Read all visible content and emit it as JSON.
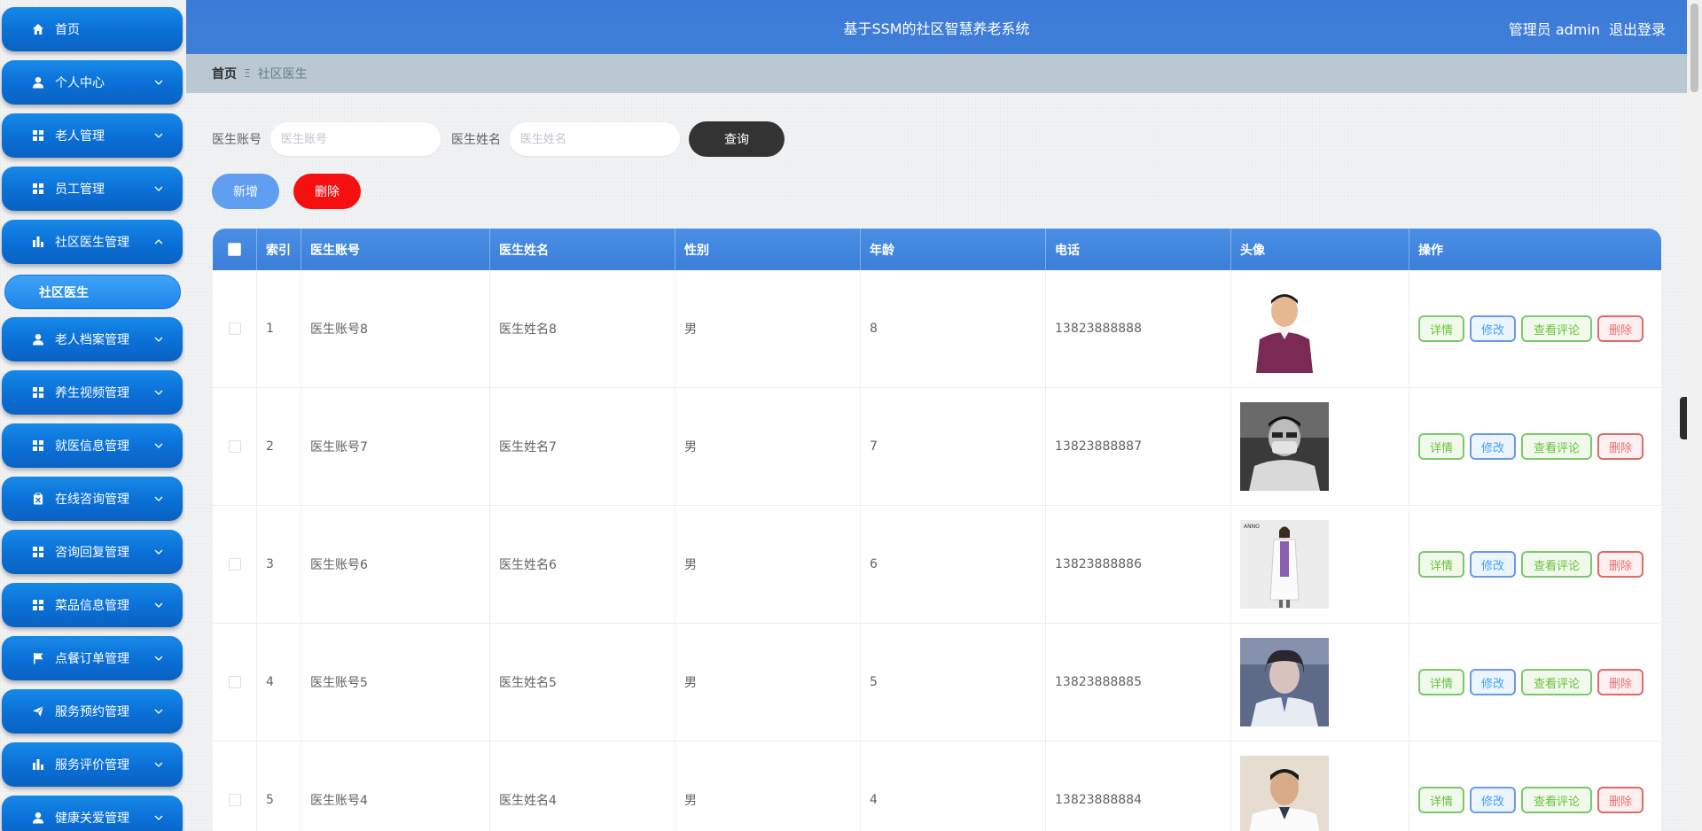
{
  "header": {
    "title": "基于SSM的社区智慧养老系统",
    "user_label": "管理员 admin",
    "logout_label": "退出登录"
  },
  "sidebar": {
    "items": [
      {
        "label": "首页",
        "icon": "home-icon",
        "arrow": ""
      },
      {
        "label": "个人中心",
        "icon": "user-icon",
        "arrow": "down"
      },
      {
        "label": "老人管理",
        "icon": "grid-icon",
        "arrow": "down"
      },
      {
        "label": "员工管理",
        "icon": "grid-icon",
        "arrow": "down"
      },
      {
        "label": "社区医生管理",
        "icon": "bar-chart-icon",
        "arrow": "up"
      },
      {
        "label": "老人档案管理",
        "icon": "user-icon",
        "arrow": "down"
      },
      {
        "label": "养生视频管理",
        "icon": "grid-icon",
        "arrow": "down"
      },
      {
        "label": "就医信息管理",
        "icon": "grid-icon",
        "arrow": "down"
      },
      {
        "label": "在线咨询管理",
        "icon": "clipboard-icon",
        "arrow": "down"
      },
      {
        "label": "咨询回复管理",
        "icon": "grid-icon",
        "arrow": "down"
      },
      {
        "label": "菜品信息管理",
        "icon": "grid-icon",
        "arrow": "down"
      },
      {
        "label": "点餐订单管理",
        "icon": "flag-icon",
        "arrow": "down"
      },
      {
        "label": "服务预约管理",
        "icon": "send-icon",
        "arrow": "down"
      },
      {
        "label": "服务评价管理",
        "icon": "bar-chart-icon",
        "arrow": "down"
      },
      {
        "label": "健康关爱管理",
        "icon": "user-icon",
        "arrow": "down"
      }
    ],
    "submenu_active": "社区医生"
  },
  "breadcrumb": {
    "home": "首页",
    "separator": "Ξ",
    "current": "社区医生"
  },
  "search": {
    "account_label": "医生账号",
    "account_placeholder": "医生账号",
    "name_label": "医生姓名",
    "name_placeholder": "医生姓名",
    "query_button": "查询"
  },
  "actions": {
    "add_button": "新增",
    "delete_button": "删除"
  },
  "table": {
    "headers": [
      "索引",
      "医生账号",
      "医生姓名",
      "性别",
      "年龄",
      "电话",
      "头像",
      "操作"
    ],
    "op_labels": {
      "detail": "详情",
      "edit": "修改",
      "comment": "查看评论",
      "delete": "删除"
    },
    "rows": [
      {
        "index": "1",
        "account": "医生账号8",
        "name": "医生姓名8",
        "gender": "男",
        "age": "8",
        "phone": "13823888888"
      },
      {
        "index": "2",
        "account": "医生账号7",
        "name": "医生姓名7",
        "gender": "男",
        "age": "7",
        "phone": "13823888887"
      },
      {
        "index": "3",
        "account": "医生账号6",
        "name": "医生姓名6",
        "gender": "男",
        "age": "6",
        "phone": "13823888886"
      },
      {
        "index": "4",
        "account": "医生账号5",
        "name": "医生姓名5",
        "gender": "男",
        "age": "5",
        "phone": "13823888885"
      },
      {
        "index": "5",
        "account": "医生账号4",
        "name": "医生姓名4",
        "gender": "男",
        "age": "4",
        "phone": "13823888884"
      }
    ]
  },
  "colors": {
    "header_blue": "#3c7ad7",
    "menu_blue": "#0a6fd6",
    "delete_red": "#f50f0f",
    "query_dark": "#333333"
  }
}
